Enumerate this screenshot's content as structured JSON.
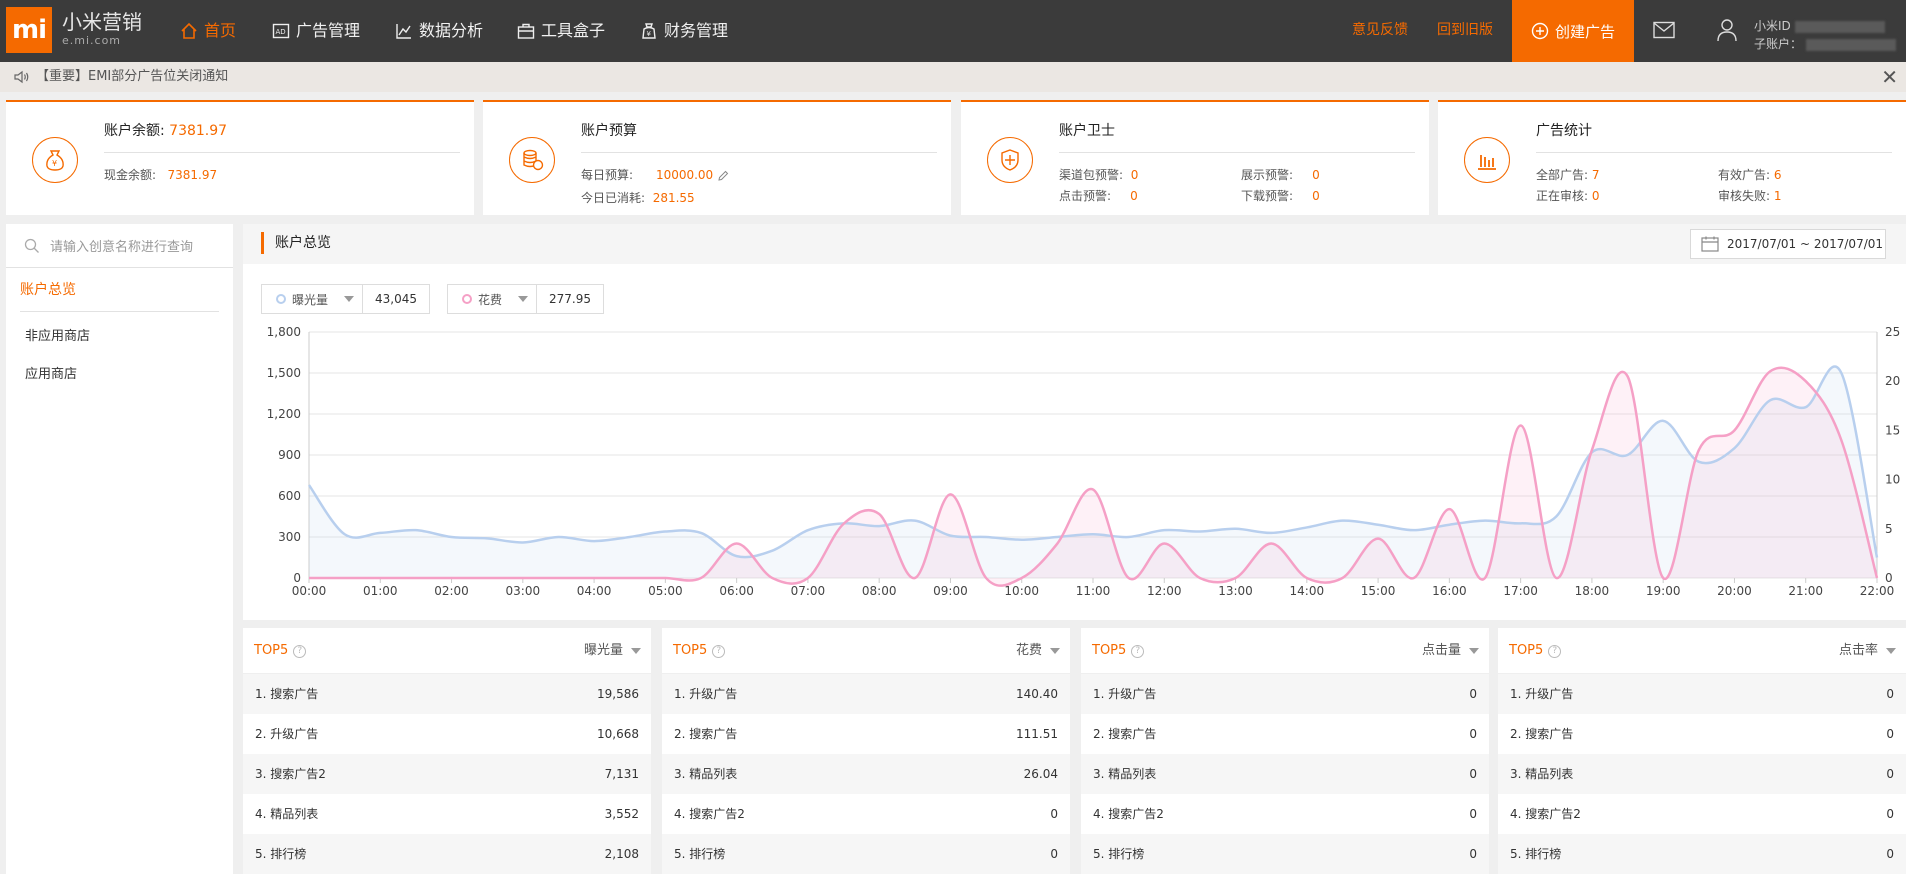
{
  "brand": {
    "logo": "mi",
    "name": "小米营销",
    "domain": "e.mi.com",
    "color": "#f56a00"
  },
  "nav": {
    "items": [
      {
        "label": "首页",
        "icon": "home-icon",
        "active": true
      },
      {
        "label": "广告管理",
        "icon": "ad-icon"
      },
      {
        "label": "数据分析",
        "icon": "chart-icon"
      },
      {
        "label": "工具盒子",
        "icon": "toolbox-icon"
      },
      {
        "label": "财务管理",
        "icon": "wallet-icon"
      }
    ],
    "feedback": "意见反馈",
    "old_version": "回到旧版",
    "create": "创建广告",
    "account_id_label": "小米ID",
    "sub_account_label": "子账户："
  },
  "notice": {
    "text": "【重要】EMI部分广告位关闭通知"
  },
  "cards": {
    "balance": {
      "title_label": "账户余额:",
      "title_value": "7381.97",
      "cash_label": "现金余额:",
      "cash_value": "7381.97"
    },
    "budget": {
      "title": "账户预算",
      "daily_label": "每日预算:",
      "daily_value": "10000.00",
      "spent_label": "今日已消耗:",
      "spent_value": "281.55"
    },
    "guard": {
      "title": "账户卫士",
      "items": [
        {
          "label": "渠道包预警:",
          "value": "0"
        },
        {
          "label": "展示预警:",
          "value": "0"
        },
        {
          "label": "点击预警:",
          "value": "0"
        },
        {
          "label": "下载预警:",
          "value": "0"
        }
      ]
    },
    "stats": {
      "title": "广告统计",
      "items": [
        {
          "label": "全部广告:",
          "value": "7"
        },
        {
          "label": "有效广告:",
          "value": "6"
        },
        {
          "label": "正在审核:",
          "value": "0"
        },
        {
          "label": "审核失败:",
          "value": "1"
        }
      ]
    }
  },
  "sidebar": {
    "search_placeholder": "请输入创意名称进行查询",
    "header": "账户总览",
    "items": [
      "非应用商店",
      "应用商店"
    ]
  },
  "main": {
    "title": "账户总览",
    "date_range": "2017/07/01 ~ 2017/07/01",
    "metrics": [
      {
        "label": "曝光量",
        "value": "43,045",
        "color": "#b8cfee"
      },
      {
        "label": "花费",
        "value": "277.95",
        "color": "#f5a0c6"
      }
    ]
  },
  "chart_data": {
    "type": "line",
    "x": [
      "00:00",
      "00:30",
      "01:00",
      "01:30",
      "02:00",
      "02:30",
      "03:00",
      "03:30",
      "04:00",
      "04:30",
      "05:00",
      "05:30",
      "06:00",
      "06:30",
      "07:00",
      "07:30",
      "08:00",
      "08:30",
      "09:00",
      "09:30",
      "10:00",
      "10:30",
      "11:00",
      "11:30",
      "12:00",
      "12:30",
      "13:00",
      "13:30",
      "14:00",
      "14:30",
      "15:00",
      "15:30",
      "16:00",
      "16:30",
      "17:00",
      "17:30",
      "18:00",
      "18:30",
      "19:00",
      "19:30",
      "20:00",
      "20:30",
      "21:00",
      "21:30",
      "22:00"
    ],
    "x_ticks": [
      "00:00",
      "01:00",
      "02:00",
      "03:00",
      "04:00",
      "05:00",
      "06:00",
      "07:00",
      "08:00",
      "09:00",
      "10:00",
      "11:00",
      "12:00",
      "13:00",
      "14:00",
      "15:00",
      "16:00",
      "17:00",
      "18:00",
      "19:00",
      "20:00",
      "21:00",
      "22:00"
    ],
    "series": [
      {
        "name": "曝光量",
        "axis": "left",
        "color": "#b8cfee",
        "values": [
          680,
          320,
          330,
          350,
          300,
          290,
          260,
          300,
          270,
          300,
          340,
          330,
          160,
          200,
          350,
          400,
          380,
          420,
          310,
          300,
          280,
          300,
          320,
          300,
          350,
          340,
          360,
          330,
          370,
          420,
          390,
          350,
          390,
          420,
          400,
          450,
          920,
          900,
          1150,
          850,
          950,
          1300,
          1250,
          1500,
          150
        ]
      },
      {
        "name": "花费",
        "axis": "right",
        "color": "#f5a0c6",
        "values": [
          0,
          0,
          0,
          0,
          0,
          0,
          0,
          0,
          0,
          0,
          0,
          0,
          3.5,
          0,
          0,
          5.5,
          6.5,
          0,
          8.5,
          0,
          0,
          3.5,
          9,
          0,
          3.5,
          0,
          0,
          3.5,
          0,
          0,
          4,
          0,
          7,
          0,
          15.5,
          0,
          13,
          20.5,
          0,
          13,
          15,
          21,
          20,
          14,
          0
        ]
      }
    ],
    "ylim_left": [
      0,
      1800
    ],
    "yticks_left": [
      0,
      300,
      600,
      900,
      1200,
      1500,
      1800
    ],
    "yticks_left_labels": [
      "0",
      "300",
      "600",
      "900",
      "1,200",
      "1,500",
      "1,800"
    ],
    "ylim_right": [
      0,
      25
    ],
    "yticks_right": [
      0,
      5,
      10,
      15,
      20,
      25
    ],
    "grid": true
  },
  "top5": [
    {
      "title": "TOP5",
      "metric": "曝光量",
      "rows": [
        {
          "name": "1. 搜索广告",
          "value": "19,586"
        },
        {
          "name": "2. 升级广告",
          "value": "10,668"
        },
        {
          "name": "3. 搜索广告2",
          "value": "7,131"
        },
        {
          "name": "4. 精品列表",
          "value": "3,552"
        },
        {
          "name": "5. 排行榜",
          "value": "2,108"
        }
      ]
    },
    {
      "title": "TOP5",
      "metric": "花费",
      "rows": [
        {
          "name": "1. 升级广告",
          "value": "140.40"
        },
        {
          "name": "2. 搜索广告",
          "value": "111.51"
        },
        {
          "name": "3. 精品列表",
          "value": "26.04"
        },
        {
          "name": "4. 搜索广告2",
          "value": "0"
        },
        {
          "name": "5. 排行榜",
          "value": "0"
        }
      ]
    },
    {
      "title": "TOP5",
      "metric": "点击量",
      "rows": [
        {
          "name": "1. 升级广告",
          "value": "0"
        },
        {
          "name": "2. 搜索广告",
          "value": "0"
        },
        {
          "name": "3. 精品列表",
          "value": "0"
        },
        {
          "name": "4. 搜索广告2",
          "value": "0"
        },
        {
          "name": "5. 排行榜",
          "value": "0"
        }
      ]
    },
    {
      "title": "TOP5",
      "metric": "点击率",
      "rows": [
        {
          "name": "1. 升级广告",
          "value": "0"
        },
        {
          "name": "2. 搜索广告",
          "value": "0"
        },
        {
          "name": "3. 精品列表",
          "value": "0"
        },
        {
          "name": "4. 搜索广告2",
          "value": "0"
        },
        {
          "name": "5. 排行榜",
          "value": "0"
        }
      ]
    }
  ]
}
